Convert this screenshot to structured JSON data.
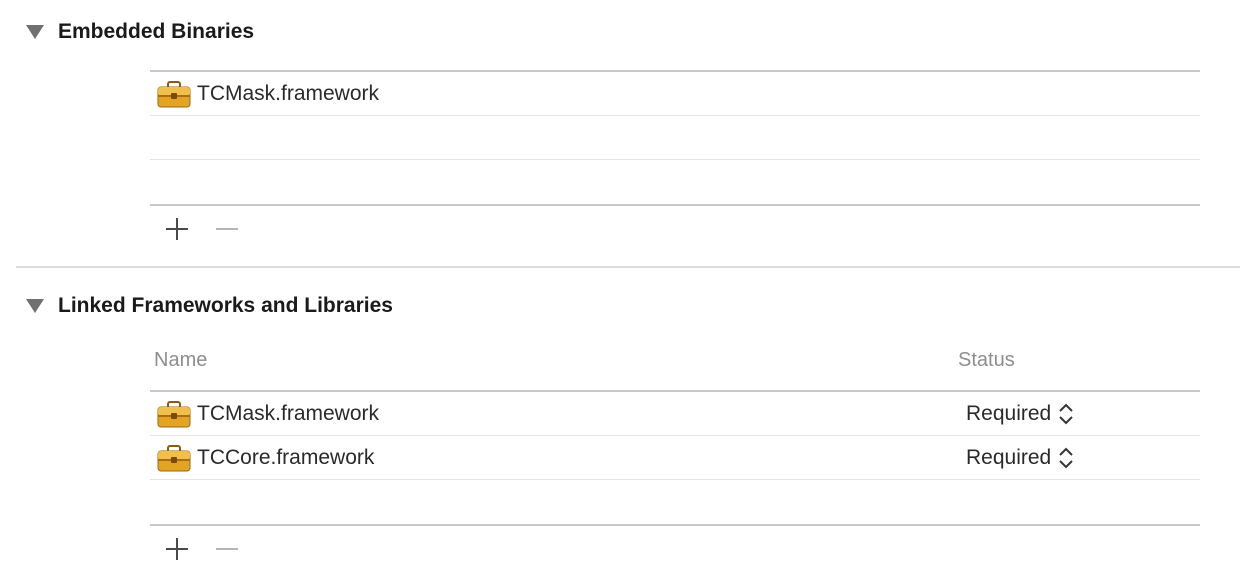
{
  "embedded_binaries": {
    "title": "Embedded Binaries",
    "items": [
      {
        "name": "TCMask.framework",
        "icon": "toolbox-framework-icon"
      }
    ],
    "add_icon": "plus-icon",
    "remove_icon": "minus-icon"
  },
  "linked_frameworks": {
    "title": "Linked Frameworks and Libraries",
    "columns": {
      "name": "Name",
      "status": "Status"
    },
    "items": [
      {
        "name": "TCMask.framework",
        "status": "Required",
        "icon": "toolbox-framework-icon"
      },
      {
        "name": "TCCore.framework",
        "status": "Required",
        "icon": "toolbox-framework-icon"
      }
    ],
    "add_icon": "plus-icon",
    "remove_icon": "minus-icon"
  },
  "colors": {
    "framework_icon": "#e0a325",
    "disclosure": "#707070",
    "header_text": "#8e8e8e",
    "separator": "#dcdcdc"
  }
}
